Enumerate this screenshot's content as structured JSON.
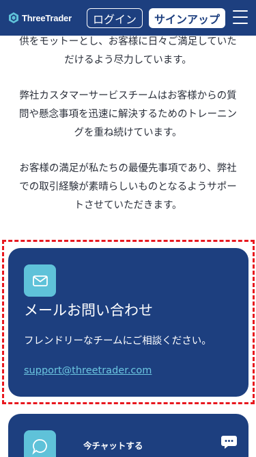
{
  "header": {
    "logo_text": "ThreeTrader",
    "login_label": "ログイン",
    "signup_label": "サインアップ",
    "menu_icon": "hamburger-menu-icon"
  },
  "content": {
    "paragraph1_line1": "供をモットーとし、お客様に日々ご満足していた",
    "paragraph1_line2": "だけるよう尽力しています。",
    "paragraph2_line1": "弊社カスタマーサービスチームはお客様からの質",
    "paragraph2_line2": "問や懸念事項を迅速に解決するためのトレーニン",
    "paragraph2_line3": "グを重ね続けています。",
    "paragraph3_line1": "お客様の満足が私たちの最優先事項であり、弊社",
    "paragraph3_line2": "での取引経験が素晴らしいものとなるようサポー",
    "paragraph3_line3": "トさせていただきます。"
  },
  "email_card": {
    "icon": "envelope-icon",
    "title": "メールお問い合わせ",
    "subtitle": "フレンドリーなチームにご相談ください。",
    "link": "support@threetrader.com"
  },
  "chat_card": {
    "icon": "chat-bubble-icon",
    "title": "今チャットする"
  },
  "chat_widget": {
    "icon": "chat-widget-icon"
  },
  "colors": {
    "brand_navy": "#1d3f7f",
    "accent_cyan": "#5fc2d9",
    "link_cyan": "#6cc6e0",
    "highlight_red": "#e8181f"
  }
}
